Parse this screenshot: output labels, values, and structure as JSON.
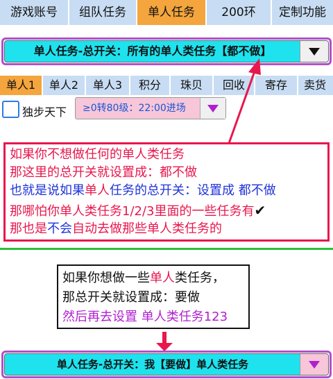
{
  "top_tabs": [
    "游戏账号",
    "组队任务",
    "单人任务",
    "200环",
    "定制功能"
  ],
  "main_switch": {
    "label": "单人任务-总开关：所有的单人类任务【都不做】"
  },
  "sub_tabs": [
    "单人1",
    "单人2",
    "单人3",
    "积分",
    "珠贝",
    "回收",
    "寄存",
    "卖货"
  ],
  "option": {
    "checkbox_label": "独步天下",
    "level_select": "≥0转80级：22:00进场"
  },
  "red_note": {
    "line1": "如果你不想做任何的单人类任务",
    "line2": "那这里的总开关就设置成：都不做",
    "line3a": "也就是说如果",
    "line3b": "单人",
    "line3c": "任务的总开关：设置成 都不做",
    "line4a": "那哪怕你单人类任务1/2/3里面的一些任务有",
    "line4b": "✔",
    "line5a": "那也是",
    "line5b": "不会",
    "line5c": "自动去做那些单人类任务的"
  },
  "black_note": {
    "line1a": "如果你想做一些",
    "line1b": "单人",
    "line1c": "类任务，",
    "line2": "那总开关就设置成：要做",
    "line3a": "然后再去设置 ",
    "line3b": "单人类任务123"
  },
  "bottom_switch": {
    "label": "单人任务-总开关：我【要做】单人类任务"
  },
  "colors": {
    "accent_tab": "#f4a53d",
    "tab": "#c8ddf3",
    "dropdown": "#1ee3ee",
    "note_border": "#e8174d",
    "divider": "#2bbf3a"
  }
}
